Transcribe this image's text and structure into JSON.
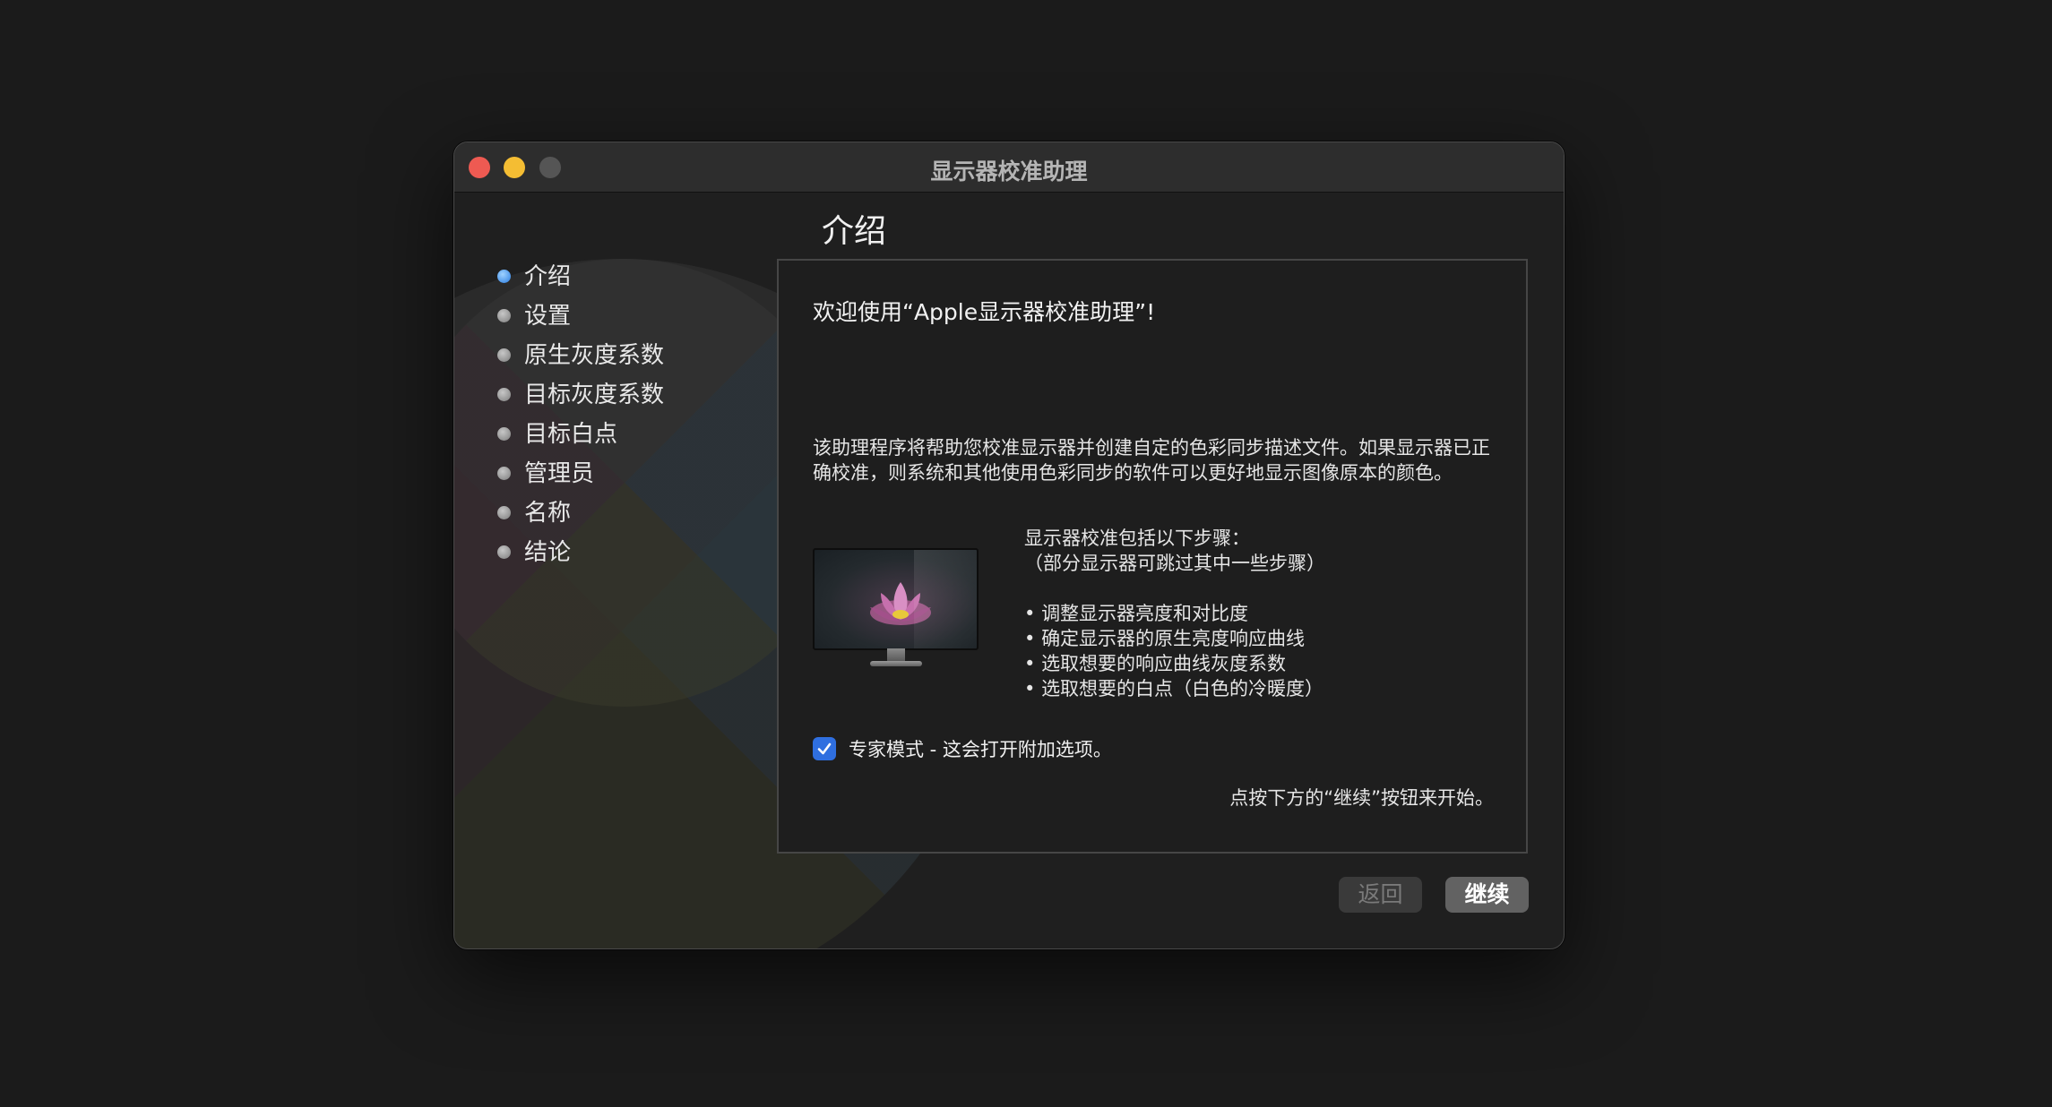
{
  "window": {
    "title": "显示器校准助理"
  },
  "sidebar": {
    "steps": [
      {
        "label": "介绍",
        "active": true
      },
      {
        "label": "设置",
        "active": false
      },
      {
        "label": "原生灰度系数",
        "active": false
      },
      {
        "label": "目标灰度系数",
        "active": false
      },
      {
        "label": "目标白点",
        "active": false
      },
      {
        "label": "管理员",
        "active": false
      },
      {
        "label": "名称",
        "active": false
      },
      {
        "label": "结论",
        "active": false
      }
    ]
  },
  "main": {
    "section_title": "介绍",
    "welcome": "欢迎使用“Apple显示器校准助理”!",
    "description": "该助理程序将帮助您校准显示器并创建自定的色彩同步描述文件。如果显示器已正确校准，则系统和其他使用色彩同步的软件可以更好地显示图像原本的颜色。",
    "steps_intro_line1": "显示器校准包括以下步骤：",
    "steps_intro_line2": "（部分显示器可跳过其中一些步骤）",
    "steps": [
      "调整显示器亮度和对比度",
      "确定显示器的原生亮度响应曲线",
      "选取想要的响应曲线灰度系数",
      "选取想要的白点（白色的冷暖度）"
    ],
    "expert_mode": {
      "label": "专家模式 - 这会打开附加选项。",
      "checked": true
    },
    "hint": "点按下方的“继续”按钮来开始。"
  },
  "buttons": {
    "back": "返回",
    "continue": "继续"
  },
  "colors": {
    "accent": "#2f6fe0",
    "close": "#ee5a52",
    "minimize": "#f4bd33",
    "zoom": "#555555"
  }
}
